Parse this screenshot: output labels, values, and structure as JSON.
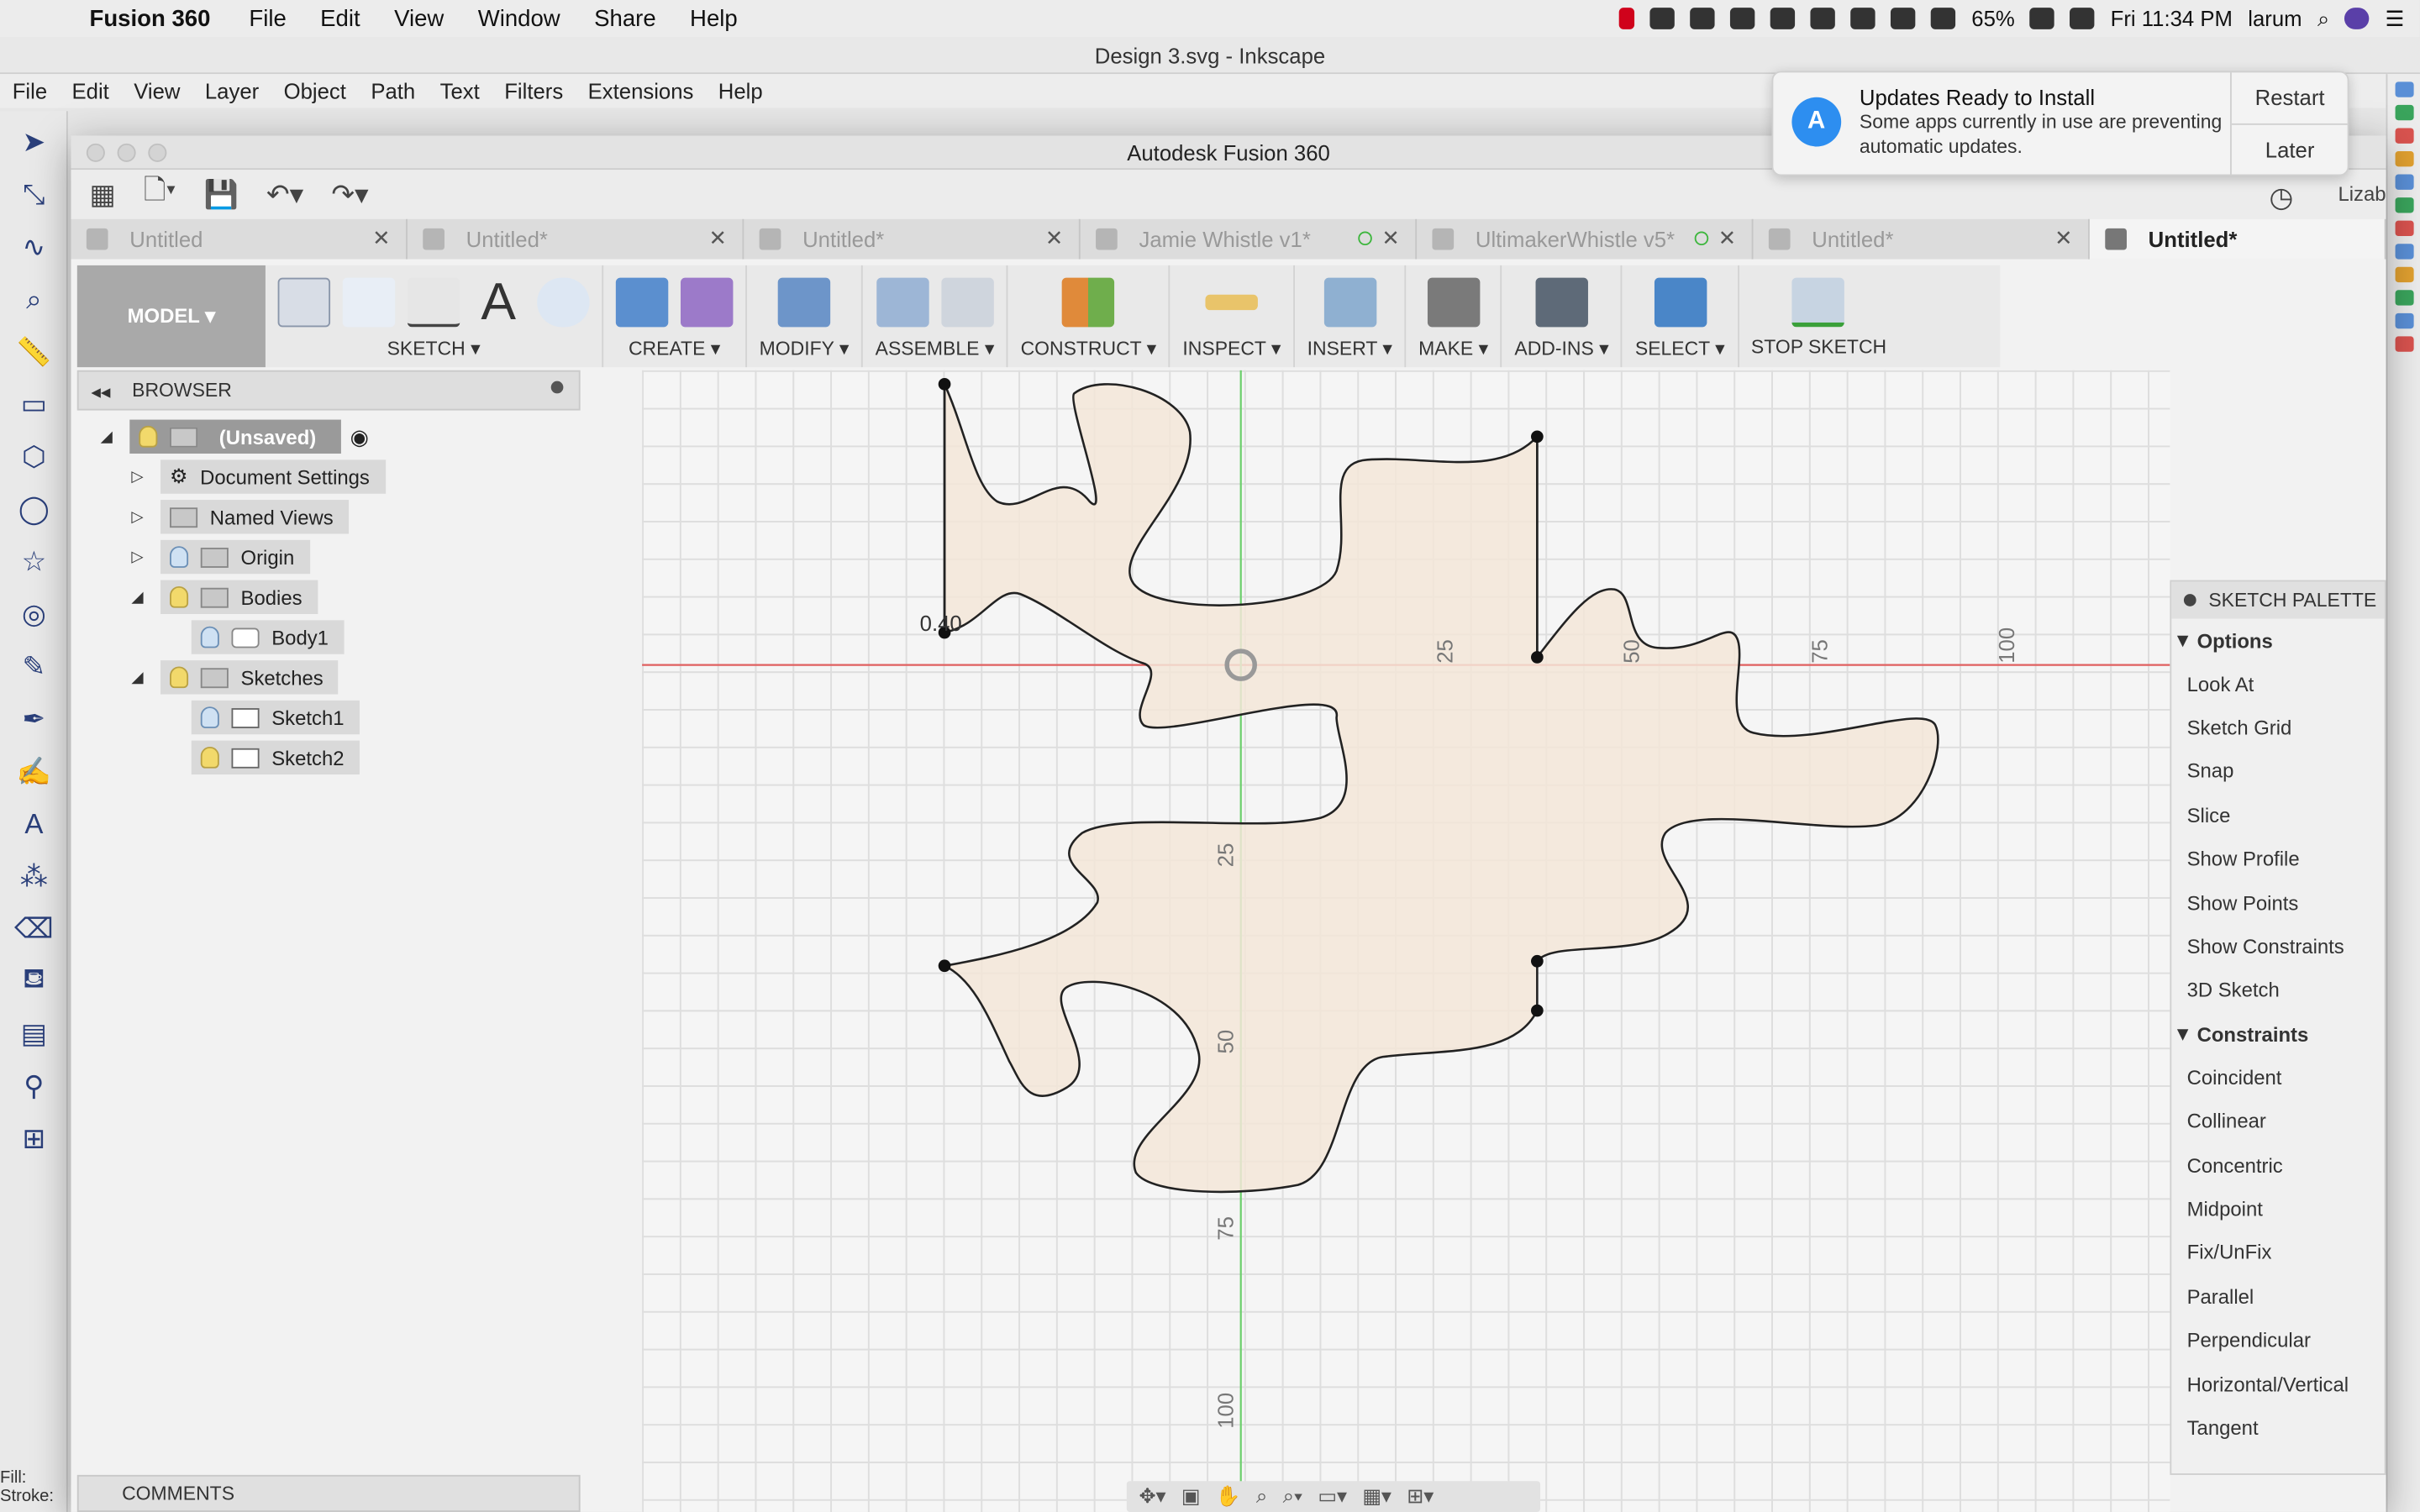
{
  "menubar": {
    "app_name": "Fusion 360",
    "items": [
      "File",
      "Edit",
      "View",
      "Window",
      "Share",
      "Help"
    ],
    "battery": "65%",
    "clock": "Fri 11:34 PM",
    "user": "larum"
  },
  "inkscape": {
    "title": "Design 3.svg - Inkscape",
    "menu": [
      "File",
      "Edit",
      "View",
      "Layer",
      "Object",
      "Path",
      "Text",
      "Filters",
      "Extensions",
      "Help"
    ],
    "fill_label": "Fill:",
    "stroke_label": "Stroke:"
  },
  "fusion": {
    "title": "Autodesk Fusion 360",
    "user_short": "Lizab",
    "tabs": [
      {
        "label": "Untitled"
      },
      {
        "label": "Untitled*"
      },
      {
        "label": "Untitled*"
      },
      {
        "label": "Jamie Whistle v1*"
      },
      {
        "label": "UltimakerWhistle v5*"
      },
      {
        "label": "Untitled*"
      },
      {
        "label": "Untitled*"
      }
    ],
    "workspace": "MODEL ▾",
    "toolbar": {
      "sketch": "SKETCH ▾",
      "create": "CREATE ▾",
      "modify": "MODIFY ▾",
      "assemble": "ASSEMBLE ▾",
      "construct": "CONSTRUCT ▾",
      "inspect": "INSPECT ▾",
      "insert": "INSERT ▾",
      "make": "MAKE ▾",
      "addins": "ADD-INS ▾",
      "select": "SELECT ▾",
      "stop_sketch": "STOP SKETCH"
    },
    "browser": {
      "title": "BROWSER",
      "root": "(Unsaved)",
      "document_settings": "Document Settings",
      "named_views": "Named Views",
      "origin": "Origin",
      "bodies": "Bodies",
      "body1": "Body1",
      "sketches": "Sketches",
      "sketch1": "Sketch1",
      "sketch2": "Sketch2"
    },
    "comments": "COMMENTS",
    "canvas": {
      "ticks_x": [
        "25",
        "50",
        "75",
        "100"
      ],
      "ticks_y": [
        "25",
        "50",
        "75",
        "100"
      ],
      "dimension": "0.40"
    },
    "palette": {
      "title": "SKETCH PALETTE",
      "options_label": "Options",
      "options": [
        "Look At",
        "Sketch Grid",
        "Snap",
        "Slice",
        "Show Profile",
        "Show Points",
        "Show Constraints",
        "3D Sketch"
      ],
      "constraints_label": "Constraints",
      "constraints": [
        "Coincident",
        "Collinear",
        "Concentric",
        "Midpoint",
        "Fix/UnFix",
        "Parallel",
        "Perpendicular",
        "Horizontal/Vertical",
        "Tangent"
      ]
    }
  },
  "notification": {
    "title": "Updates Ready to Install",
    "body": "Some apps currently in use are preventing automatic updates.",
    "restart": "Restart",
    "later": "Later"
  },
  "colors": {
    "x_axis": "#e06060",
    "y_axis": "#6ccf6c",
    "profile_fill": "#f3e6d8",
    "select_accent": "#4a86c8"
  }
}
